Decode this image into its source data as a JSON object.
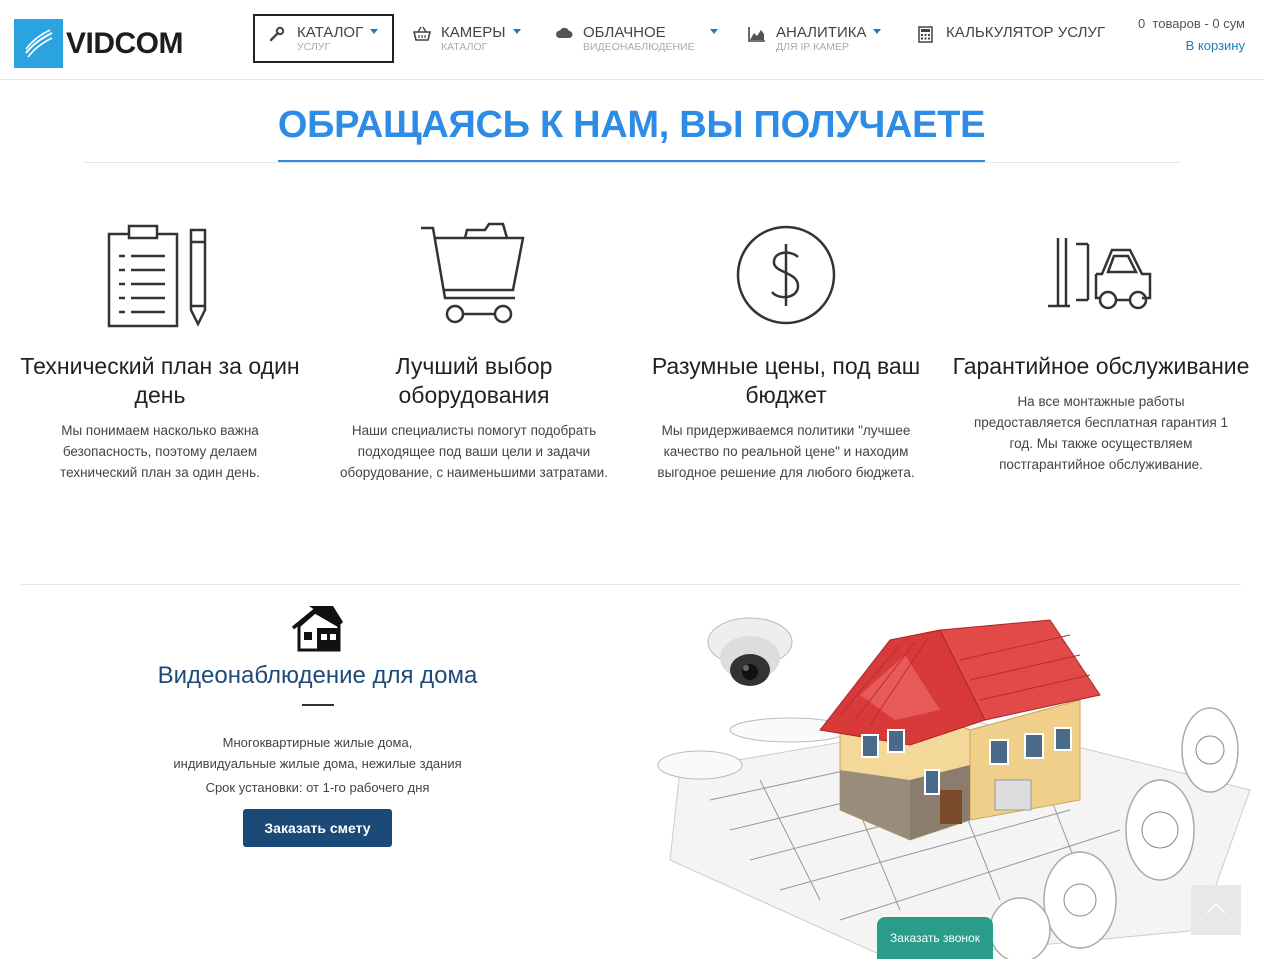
{
  "brand": {
    "name": "VIDCOM",
    "accent": "#2aa3e0"
  },
  "nav": [
    {
      "label": "КАТАЛОГ",
      "sub": "УСЛУГ",
      "icon": "wrench-icon",
      "caret": true,
      "active": true
    },
    {
      "label": "КАМЕРЫ",
      "sub": "КАТАЛОГ",
      "icon": "basket-icon",
      "caret": true
    },
    {
      "label": "ОБЛАЧНОЕ",
      "sub": "ВИДЕОНАБЛЮДЕНИЕ",
      "icon": "cloud-icon",
      "caret": true
    },
    {
      "label": "АНАЛИТИКА",
      "sub": "ДЛЯ IP КАМЕР",
      "icon": "chart-icon",
      "caret": true
    },
    {
      "label": "КАЛЬКУЛЯТОР УСЛУГ",
      "sub": "",
      "icon": "calculator-icon",
      "caret": false
    }
  ],
  "cart": {
    "count_text": "0  товаров - 0 сум",
    "link": "В корзину"
  },
  "section": {
    "title": "ОБРАЩАЯСЬ К НАМ, ВЫ ПОЛУЧАЕТЕ",
    "accent": "#2f8ce4"
  },
  "features": [
    {
      "icon": "clipboard-pencil-icon",
      "title": "Технический план за один день",
      "text": "Мы понимаем насколько важна безопасность, поэтому делаем технический план за один день."
    },
    {
      "icon": "cart-icon",
      "title": "Лучший выбор оборудования",
      "text": "Наши специалисты помогут подобрать подходящее под ваши цели и задачи оборудование, с наименьшими затратами."
    },
    {
      "icon": "dollar-coin-icon",
      "title": "Разумные цены, под ваш бюджет",
      "text": "Мы придерживаемся политики \"лучшее качество по реальной цене\" и находим выгодное решение для любого бюджета."
    },
    {
      "icon": "forklift-icon",
      "title": "Гарантийное обслуживание",
      "text": "На все монтажные работы предоставляется бесплатная гарантия 1 год. Мы также осуществляем постгарантийное обслуживание."
    }
  ],
  "home": {
    "icon": "house-icon",
    "title": "Видеонаблюдение для дома",
    "desc_line1": "Многоквартирные жилые дома,",
    "desc_line2": "индивидуальные жилые дома, нежилые здания",
    "term": "Срок установки: от 1-го рабочего дня",
    "button": "Заказать смету",
    "button_color": "#1c4a78"
  },
  "callback": {
    "label": "Заказать звонок",
    "color": "#2a9d8a"
  }
}
